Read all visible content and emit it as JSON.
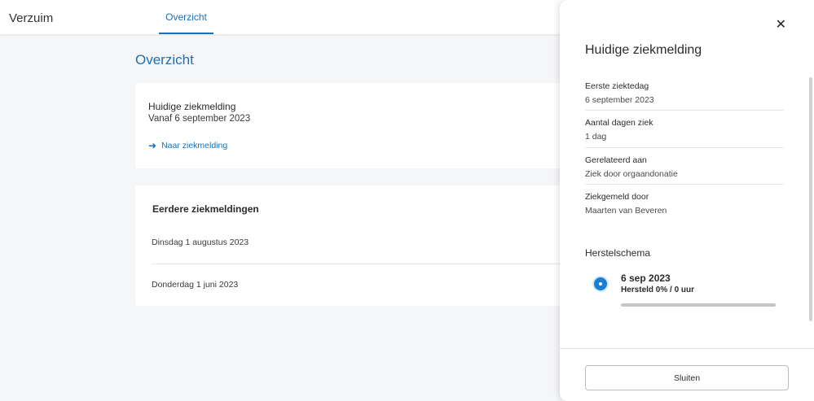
{
  "header": {
    "app_title": "Verzuim",
    "tabs": [
      {
        "label": "Overzicht",
        "active": true
      }
    ]
  },
  "main": {
    "title": "Overzicht",
    "current_card": {
      "title": "Huidige ziekmelding",
      "subtitle": "Vanaf 6 september 2023",
      "link_label": "Naar ziekmelding",
      "link_icon": "arrow-right-icon"
    },
    "previous_card": {
      "title": "Eerdere ziekmeldingen",
      "items": [
        "Dinsdag 1 augustus 2023",
        "Donderdag 1 juni 2023"
      ]
    }
  },
  "panel": {
    "title": "Huidige ziekmelding",
    "close_icon": "close-icon",
    "fields": [
      {
        "label": "Eerste ziektedag",
        "value": "6 september 2023"
      },
      {
        "label": "Aantal dagen ziek",
        "value": "1 dag"
      },
      {
        "label": "Gerelateerd aan",
        "value": "Ziek door orgaandonatie"
      },
      {
        "label": "Ziekgemeld door",
        "value": "Maarten van Beveren"
      }
    ],
    "recovery": {
      "title": "Herstelschema",
      "entries": [
        {
          "date": "6 sep 2023",
          "status": "Hersteld 0% / 0 uur",
          "progress": 0
        }
      ]
    },
    "close_button_label": "Sluiten"
  },
  "colors": {
    "accent": "#1a6fb5",
    "background": "#f5f6f8",
    "timeline_dot": "#1a7fd4"
  }
}
